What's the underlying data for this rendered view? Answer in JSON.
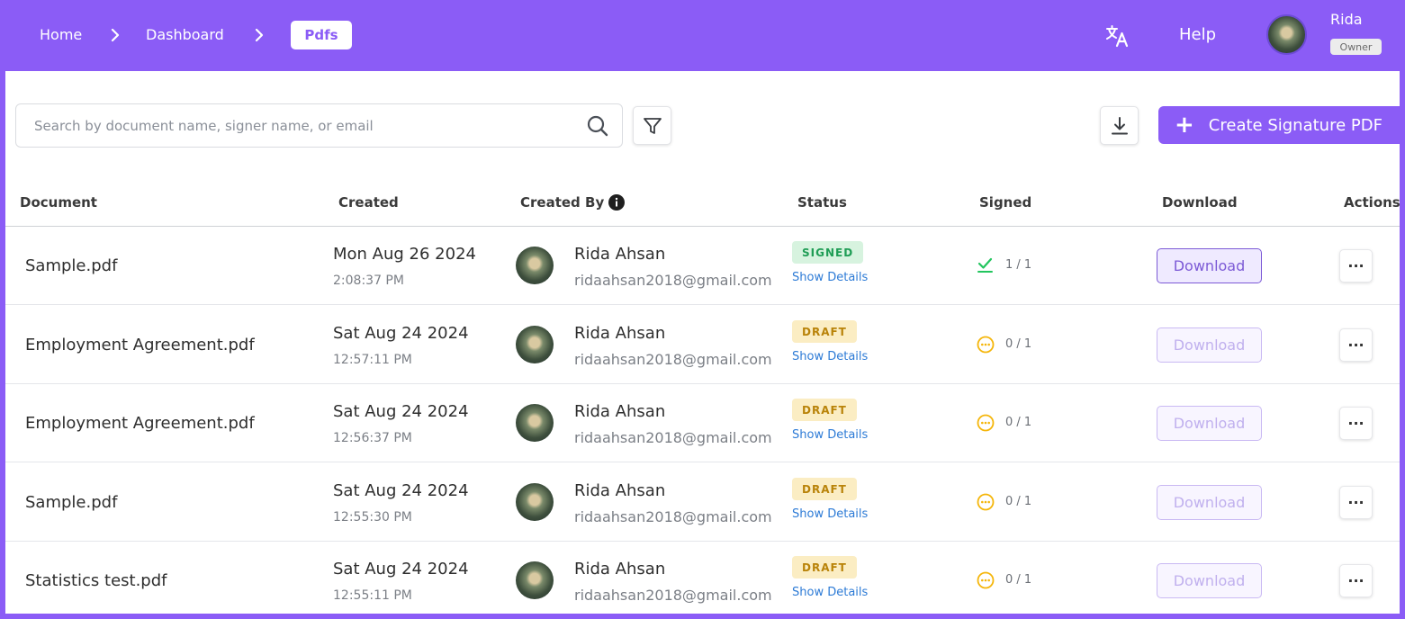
{
  "header": {
    "breadcrumbs": [
      "Home",
      "Dashboard"
    ],
    "active_crumb": "Pdfs",
    "help_label": "Help",
    "user": {
      "name": "Rida",
      "role": "Owner"
    },
    "brand_color": "#8b5cf6"
  },
  "toolbar": {
    "search_placeholder": "Search by document name, signer name, or email",
    "create_label": "Create Signature PDF"
  },
  "table": {
    "columns": [
      "Document",
      "Created",
      "Created By",
      "Status",
      "Signed",
      "Download",
      "Actions"
    ],
    "rows": [
      {
        "document": "Sample.pdf",
        "date": "Mon Aug 26 2024",
        "time": "2:08:37 PM",
        "creator_name": "Rida Ahsan",
        "creator_email": "ridaahsan2018@gmail.com",
        "status": "SIGNED",
        "details": "Show Details",
        "signed": "1 / 1",
        "download": "Download"
      },
      {
        "document": "Employment Agreement.pdf",
        "date": "Sat Aug 24 2024",
        "time": "12:57:11 PM",
        "creator_name": "Rida Ahsan",
        "creator_email": "ridaahsan2018@gmail.com",
        "status": "DRAFT",
        "details": "Show Details",
        "signed": "0 / 1",
        "download": "Download"
      },
      {
        "document": "Employment Agreement.pdf",
        "date": "Sat Aug 24 2024",
        "time": "12:56:37 PM",
        "creator_name": "Rida Ahsan",
        "creator_email": "ridaahsan2018@gmail.com",
        "status": "DRAFT",
        "details": "Show Details",
        "signed": "0 / 1",
        "download": "Download"
      },
      {
        "document": "Sample.pdf",
        "date": "Sat Aug 24 2024",
        "time": "12:55:30 PM",
        "creator_name": "Rida Ahsan",
        "creator_email": "ridaahsan2018@gmail.com",
        "status": "DRAFT",
        "details": "Show Details",
        "signed": "0 / 1",
        "download": "Download"
      },
      {
        "document": "Statistics test.pdf",
        "date": "Sat Aug 24 2024",
        "time": "12:55:11 PM",
        "creator_name": "Rida Ahsan",
        "creator_email": "ridaahsan2018@gmail.com",
        "status": "DRAFT",
        "details": "Show Details",
        "signed": "0 / 1",
        "download": "Download"
      }
    ]
  },
  "icons": {
    "translate": "translate-icon",
    "search": "search-icon",
    "filter": "filter-icon",
    "download": "download-icon",
    "info": "info-icon",
    "signed_check": "check-icon",
    "pending": "pending-icon",
    "more": "more-icon"
  }
}
